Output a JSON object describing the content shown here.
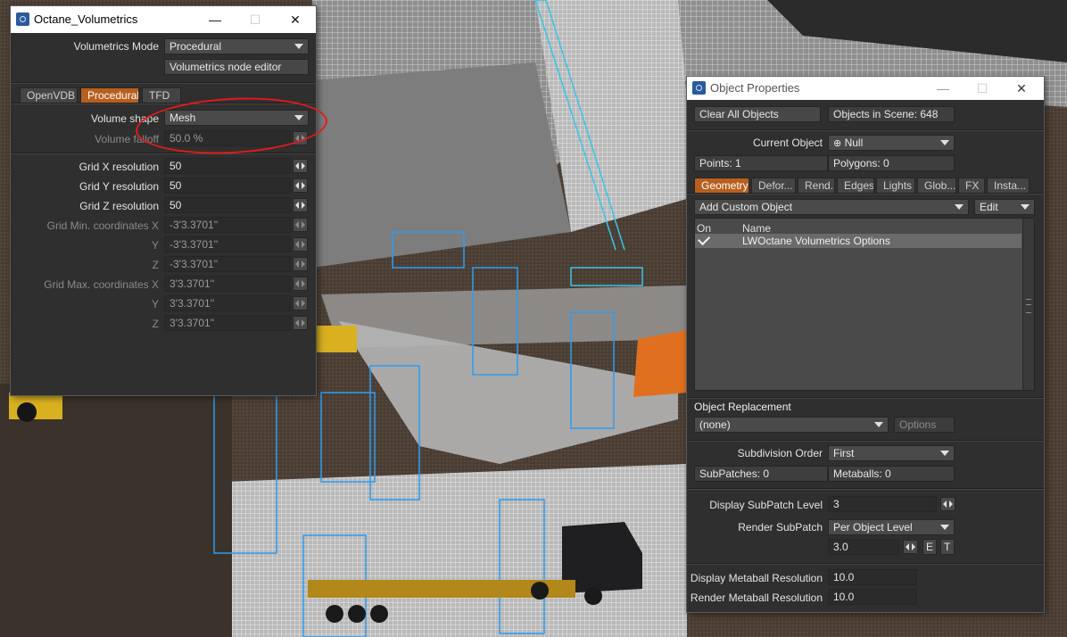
{
  "volumetrics_window": {
    "title": "Octane_Volumetrics",
    "volumetrics_mode_label": "Volumetrics Mode",
    "volumetrics_mode_value": "Procedural",
    "node_editor_button": "Volumetrics node editor",
    "tabs": [
      {
        "label": "OpenVDB",
        "active": false
      },
      {
        "label": "Procedural",
        "active": true
      },
      {
        "label": "TFD",
        "active": false
      }
    ],
    "volume_shape_label": "Volume shape",
    "volume_shape_value": "Mesh",
    "volume_falloff_label": "Volume falloff",
    "volume_falloff_value": "50.0 %",
    "grid_x_label": "Grid X resolution",
    "grid_x_value": "50",
    "grid_y_label": "Grid Y resolution",
    "grid_y_value": "50",
    "grid_z_label": "Grid Z resolution",
    "grid_z_value": "50",
    "grid_min_label": "Grid Min. coordinates X",
    "grid_min_x": "-3'3.3701''",
    "grid_min_y_label": "Y",
    "grid_min_y": "-3'3.3701''",
    "grid_min_z_label": "Z",
    "grid_min_z": "-3'3.3701''",
    "grid_max_label": "Grid Max. coordinates X",
    "grid_max_x": "3'3.3701''",
    "grid_max_y_label": "Y",
    "grid_max_y": "3'3.3701''",
    "grid_max_z_label": "Z",
    "grid_max_z": "3'3.3701''"
  },
  "object_properties_window": {
    "title": "Object Properties",
    "clear_all_button": "Clear All Objects",
    "objects_in_scene": "Objects in Scene: 648",
    "current_object_label": "Current Object",
    "current_object_value": "Null",
    "points": "Points: 1",
    "polygons": "Polygons: 0",
    "tabs": [
      {
        "label": "Geometry",
        "active": true
      },
      {
        "label": "Defor...",
        "active": false
      },
      {
        "label": "Rend...",
        "active": false
      },
      {
        "label": "Edges",
        "active": false
      },
      {
        "label": "Lights",
        "active": false
      },
      {
        "label": "Glob...",
        "active": false
      },
      {
        "label": "FX",
        "active": false
      },
      {
        "label": "Insta...",
        "active": false
      }
    ],
    "add_custom_object": "Add Custom Object",
    "edit_button": "Edit",
    "list_columns": [
      "On",
      "Name"
    ],
    "list_rows": [
      {
        "on": true,
        "name": "LWOctane Volumetrics Options"
      }
    ],
    "object_replacement_label": "Object Replacement",
    "object_replacement_value": "(none)",
    "options_button": "Options",
    "subdivision_order_label": "Subdivision Order",
    "subdivision_order_value": "First",
    "subpatches": "SubPatches: 0",
    "metaballs": "Metaballs: 0",
    "display_subpatch_label": "Display SubPatch Level",
    "display_subpatch_value": "3",
    "render_subpatch_label": "Render SubPatch",
    "render_subpatch_mode": "Per Object Level",
    "render_subpatch_value": "3.0",
    "e_button": "E",
    "t_button": "T",
    "display_metaball_label": "Display Metaball Resolution",
    "display_metaball_value": "10.0",
    "render_metaball_label": "Render Metaball Resolution",
    "render_metaball_value": "10.0"
  },
  "colors": {
    "active_tab": "#b85f1f",
    "annotation": "#e21a1a",
    "wireframe": "#2a9df4"
  }
}
